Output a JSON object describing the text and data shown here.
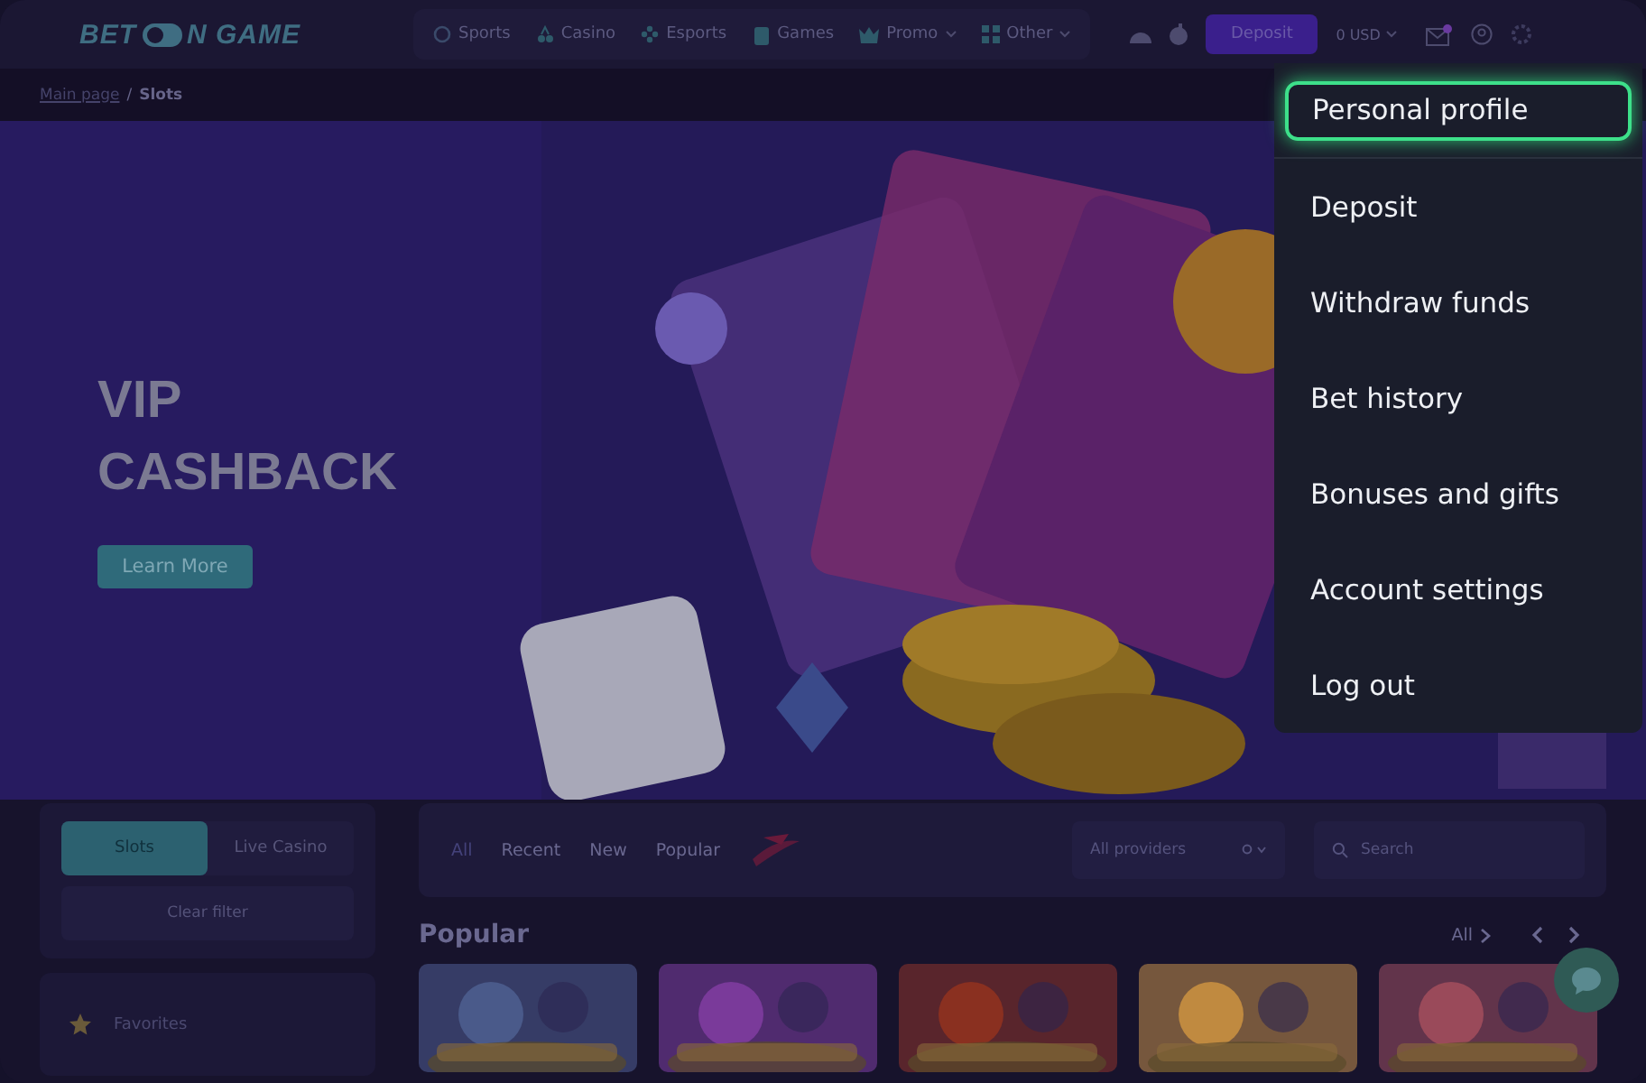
{
  "header": {
    "logo": {
      "left": "BET",
      "right": "N GAME"
    },
    "nav": [
      {
        "label": "Sports",
        "dropdown": false
      },
      {
        "label": "Casino",
        "dropdown": false
      },
      {
        "label": "Esports",
        "dropdown": false
      },
      {
        "label": "Games",
        "dropdown": false
      },
      {
        "label": "Promo",
        "dropdown": true
      },
      {
        "label": "Other",
        "dropdown": true
      }
    ],
    "deposit_button": "Deposit",
    "balance": "0 USD",
    "has_notification": true
  },
  "breadcrumb": {
    "separator": "/",
    "items": [
      {
        "label": "Main page",
        "link": true
      },
      {
        "label": "Slots",
        "link": false
      }
    ]
  },
  "banner": {
    "title_lines": [
      "VIP",
      "CASHBACK"
    ],
    "button": "Learn More"
  },
  "sidebar": {
    "tabs": [
      {
        "label": "Slots",
        "selected": true
      },
      {
        "label": "Live Casino",
        "selected": false
      }
    ],
    "clear_filter": "Clear filter",
    "items": [
      {
        "label": "Favorites"
      }
    ]
  },
  "filters": {
    "tabs": [
      {
        "label": "All",
        "selected": true
      },
      {
        "label": "Recent",
        "selected": false
      },
      {
        "label": "New",
        "selected": false
      },
      {
        "label": "Popular",
        "selected": false
      }
    ],
    "providers": {
      "placeholder": "All providers"
    },
    "search": {
      "placeholder": "Search"
    }
  },
  "section": {
    "title": "Popular",
    "all_link": "All"
  },
  "account_menu": [
    {
      "label": "Personal profile",
      "selected": true
    },
    {
      "label": "Deposit",
      "selected": false
    },
    {
      "label": "Withdraw funds",
      "selected": false
    },
    {
      "label": "Bet history",
      "selected": false
    },
    {
      "label": "Bonuses and gifts",
      "selected": false
    },
    {
      "label": "Account settings",
      "selected": false
    },
    {
      "label": "Log out",
      "selected": false
    }
  ]
}
